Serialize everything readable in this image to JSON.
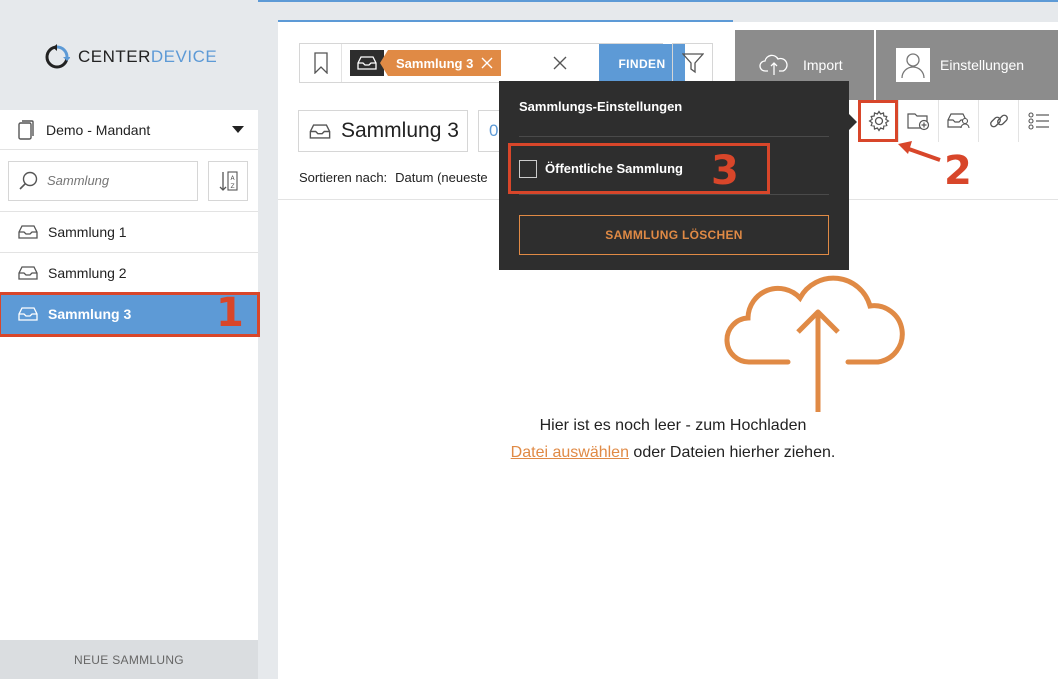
{
  "logo": {
    "part1": "CENTER",
    "part2": "DEVICE"
  },
  "sidebar": {
    "tenant": "Demo - Mandant",
    "search_placeholder": "Sammlung",
    "collections": [
      {
        "label": "Sammlung 1"
      },
      {
        "label": "Sammlung 2"
      },
      {
        "label": "Sammlung 3"
      }
    ],
    "new_collection": "NEUE SAMMLUNG"
  },
  "search": {
    "tag": "Sammlung 3",
    "find_label": "FINDEN"
  },
  "header": {
    "import_label": "Import",
    "settings_label": "Einstellungen"
  },
  "main": {
    "title": "Sammlung 3",
    "count": "0",
    "sort_label": "Sortieren nach:",
    "sort_value": "Datum (neueste",
    "empty_line1": "Hier ist es noch leer - zum Hochladen",
    "empty_link": "Datei auswählen",
    "empty_line2_rest": " oder Dateien hierher ziehen."
  },
  "popover": {
    "title": "Sammlungs-Einstellungen",
    "public_label": "Öffentliche Sammlung",
    "delete_label": "SAMMLUNG LÖSCHEN"
  },
  "annotations": {
    "n1": "1",
    "n2": "2",
    "n3": "3"
  },
  "colors": {
    "accent": "#5d9ad6",
    "orange": "#e08a45",
    "highlight": "#d8462a"
  }
}
